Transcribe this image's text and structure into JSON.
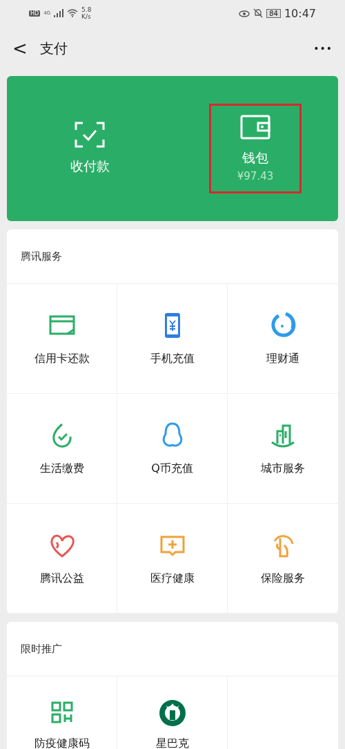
{
  "status_bar": {
    "hd": "HD",
    "network": "4G",
    "speed": "5.8",
    "speed_unit": "K/s",
    "battery": "84",
    "time": "10:47"
  },
  "header": {
    "back": "<",
    "title": "支付",
    "more": "•••"
  },
  "top_card": {
    "items": [
      {
        "label": "收付款",
        "highlighted": false
      },
      {
        "label": "钱包",
        "amount": "¥97.43",
        "highlighted": true
      }
    ]
  },
  "sections": [
    {
      "title": "腾讯服务",
      "items": [
        "信用卡还款",
        "手机充值",
        "理财通",
        "生活缴费",
        "Q币充值",
        "城市服务",
        "腾讯公益",
        "医疗健康",
        "保险服务"
      ]
    },
    {
      "title": "限时推广",
      "items": [
        "防疫健康码",
        "星巴克"
      ]
    }
  ]
}
